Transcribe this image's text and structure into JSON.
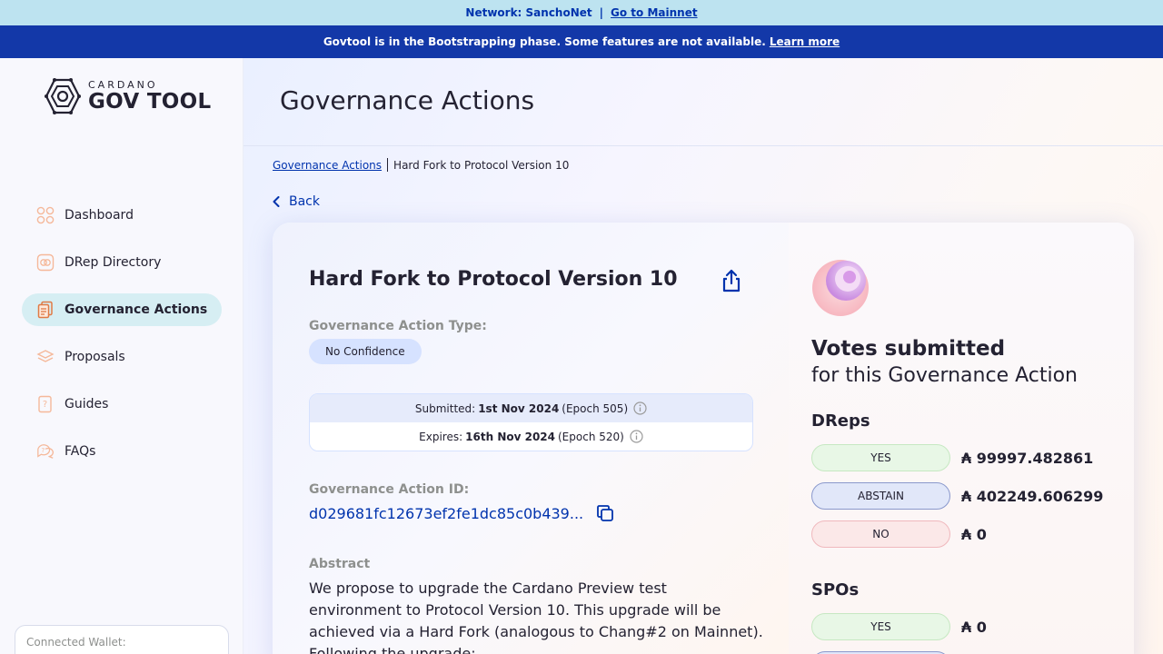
{
  "network_bar": {
    "label": "Network: SanchoNet",
    "separator": "|",
    "link": "Go to Mainnet"
  },
  "bootstrap_bar": {
    "text": "Govtool is in the Bootstrapping phase. Some features are not available.",
    "link": "Learn more"
  },
  "logo": {
    "top": "CARDANO",
    "bottom": "GOV TOOL"
  },
  "sidebar": {
    "items": [
      {
        "label": "Dashboard",
        "icon": "dashboard-icon"
      },
      {
        "label": "DRep Directory",
        "icon": "drep-directory-icon"
      },
      {
        "label": "Governance Actions",
        "icon": "governance-actions-icon",
        "active": true
      },
      {
        "label": "Proposals",
        "icon": "proposals-icon"
      },
      {
        "label": "Guides",
        "icon": "guides-icon"
      },
      {
        "label": "FAQs",
        "icon": "faqs-icon"
      }
    ],
    "wallet_label": "Connected Wallet:"
  },
  "header": {
    "title": "Governance Actions"
  },
  "breadcrumb": {
    "link": "Governance Actions",
    "current": "Hard Fork to Protocol Version 10"
  },
  "back_label": "Back",
  "action": {
    "title": "Hard Fork to Protocol Version 10",
    "type_label": "Governance Action Type:",
    "type_value": "No Confidence",
    "submitted": {
      "label": "Submitted:",
      "date": "1st Nov 2024",
      "epoch": "(Epoch 505)"
    },
    "expires": {
      "label": "Expires:",
      "date": "16th Nov 2024",
      "epoch": "(Epoch 520)"
    },
    "id_label": "Governance Action ID:",
    "id_value": "d029681fc12673ef2fe1dc85c0b439...",
    "abstract_label": "Abstract",
    "abstract_text": "We propose to upgrade the Cardano Preview test environment to Protocol Version 10. This upgrade will be achieved via a Hard Fork (analogous to Chang#2 on Mainnet). Following the upgrade:"
  },
  "votes": {
    "title": "Votes submitted",
    "subtitle": "for this Governance Action",
    "dreps_label": "DReps",
    "dreps": [
      {
        "label": "YES",
        "amount": "₳ 99997.482861"
      },
      {
        "label": "ABSTAIN",
        "amount": "₳ 402249.606299"
      },
      {
        "label": "NO",
        "amount": "₳ 0"
      }
    ],
    "spos_label": "SPOs",
    "spos": [
      {
        "label": "YES",
        "amount": "₳ 0"
      }
    ]
  },
  "colors": {
    "brand_blue": "#0033ad",
    "bootstrap_bar": "#1338a8",
    "network_bar": "#bde3f0",
    "active_nav": "#d6eef3"
  }
}
